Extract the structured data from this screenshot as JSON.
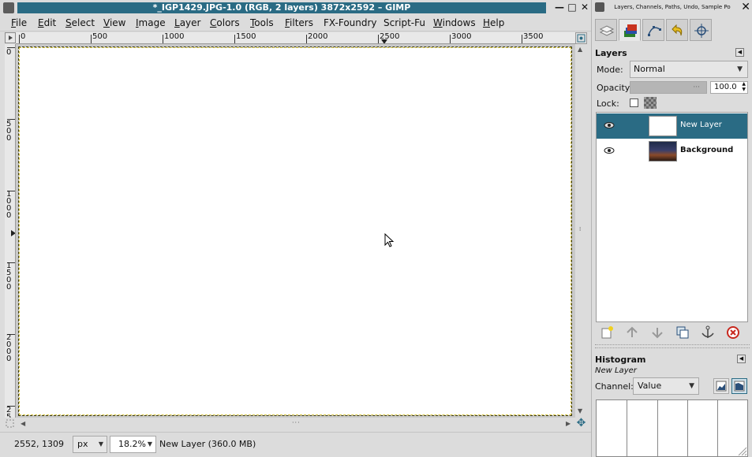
{
  "window": {
    "title": "*_IGP1429.JPG-1.0 (RGB, 2 layers) 3872x2592 – GIMP",
    "minimize": "—",
    "maximize": "□",
    "close": "✕"
  },
  "menu": [
    {
      "label": "File",
      "u": "F",
      "rest": "ile"
    },
    {
      "label": "Edit",
      "u": "E",
      "rest": "dit"
    },
    {
      "label": "Select",
      "u": "S",
      "rest": "elect"
    },
    {
      "label": "View",
      "u": "V",
      "rest": "iew"
    },
    {
      "label": "Image",
      "u": "I",
      "rest": "mage"
    },
    {
      "label": "Layer",
      "u": "L",
      "rest": "ayer"
    },
    {
      "label": "Colors",
      "u": "C",
      "rest": "olors"
    },
    {
      "label": "Tools",
      "u": "T",
      "rest": "ools"
    },
    {
      "label": "Filters",
      "u": "F",
      "rest": "ilters"
    },
    {
      "label": "FX-Foundry",
      "u": "",
      "rest": "FX-Foundry"
    },
    {
      "label": "Script-Fu",
      "u": "",
      "rest": "Script-Fu"
    },
    {
      "label": "Windows",
      "u": "W",
      "rest": "indows"
    },
    {
      "label": "Help",
      "u": "H",
      "rest": "elp"
    }
  ],
  "ruler": {
    "h_labels": [
      "0",
      "500",
      "1000",
      "1500",
      "2000",
      "2500",
      "3000",
      "3500"
    ],
    "v_labels": [
      "0",
      "500",
      "1000",
      "1500",
      "2000",
      "25"
    ]
  },
  "status": {
    "coords": "2552, 1309",
    "unit": "px",
    "zoom": "18.2%",
    "message": "New Layer (360.0 MB)"
  },
  "dock": {
    "title": "Layers, Channels, Paths, Undo, Sample Po",
    "close": "✕",
    "tabs": [
      "layers-tab-icon",
      "channels-tab-icon",
      "paths-tab-icon",
      "undo-tab-icon",
      "sample-points-tab-icon"
    ]
  },
  "layers_panel": {
    "title": "Layers",
    "mode_label": "Mode:",
    "mode_value": "Normal",
    "opacity_label": "Opacity:",
    "opacity_value": "100.0",
    "opacity_fraction": 1.0,
    "lock_label": "Lock:",
    "layers": [
      {
        "name": "New Layer",
        "selected": true,
        "visible": true,
        "thumb": "white"
      },
      {
        "name": "Background",
        "selected": false,
        "visible": true,
        "thumb": "photo"
      }
    ]
  },
  "histogram_panel": {
    "title": "Histogram",
    "subtitle": "New Layer",
    "channel_label": "Channel:",
    "channel_value": "Value"
  },
  "colors": {
    "accent": "#2a6b84",
    "selected_row": "#2a6b84",
    "canvas": "#ffffff"
  }
}
